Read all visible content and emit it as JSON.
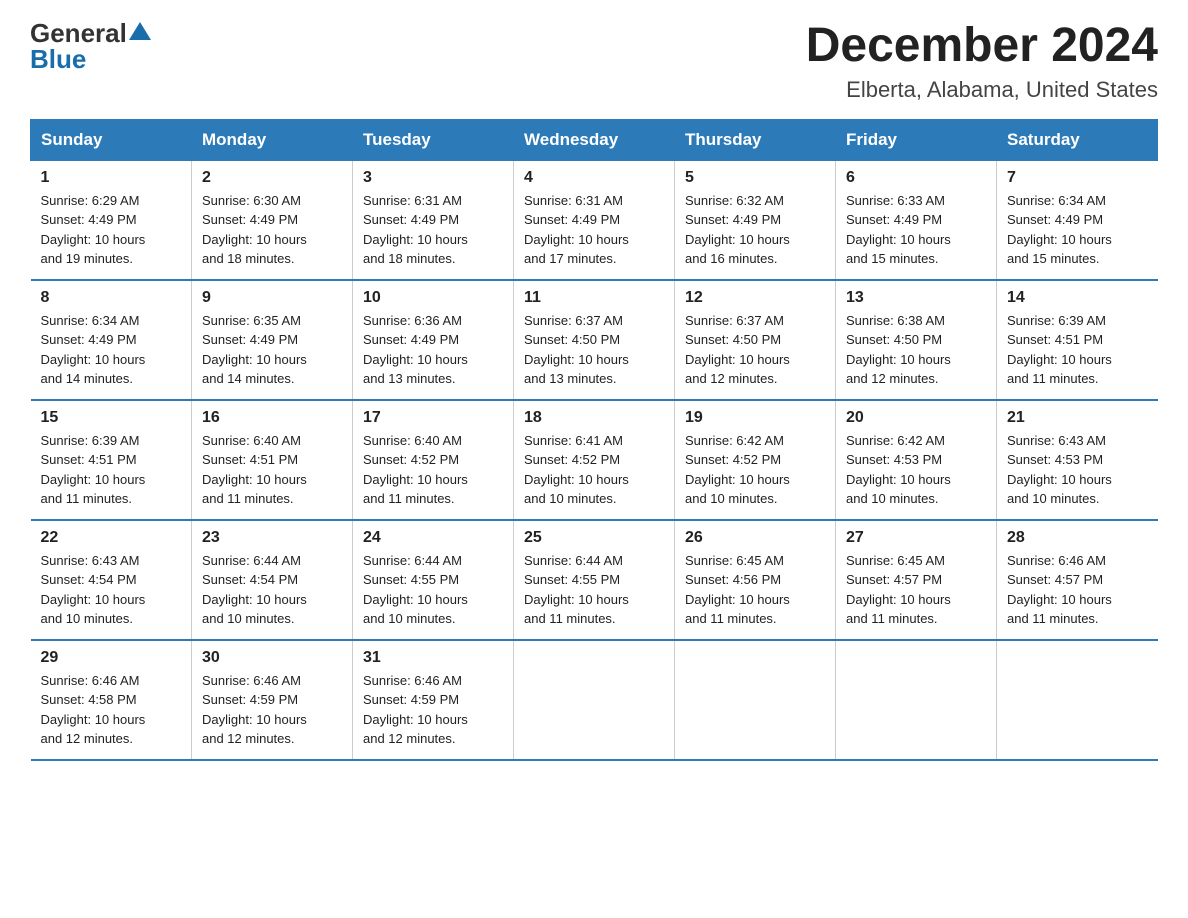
{
  "header": {
    "logo_general": "General",
    "logo_blue": "Blue",
    "title": "December 2024",
    "subtitle": "Elberta, Alabama, United States"
  },
  "days_of_week": [
    "Sunday",
    "Monday",
    "Tuesday",
    "Wednesday",
    "Thursday",
    "Friday",
    "Saturday"
  ],
  "weeks": [
    [
      {
        "day": "1",
        "sunrise": "6:29 AM",
        "sunset": "4:49 PM",
        "daylight": "10 hours and 19 minutes."
      },
      {
        "day": "2",
        "sunrise": "6:30 AM",
        "sunset": "4:49 PM",
        "daylight": "10 hours and 18 minutes."
      },
      {
        "day": "3",
        "sunrise": "6:31 AM",
        "sunset": "4:49 PM",
        "daylight": "10 hours and 18 minutes."
      },
      {
        "day": "4",
        "sunrise": "6:31 AM",
        "sunset": "4:49 PM",
        "daylight": "10 hours and 17 minutes."
      },
      {
        "day": "5",
        "sunrise": "6:32 AM",
        "sunset": "4:49 PM",
        "daylight": "10 hours and 16 minutes."
      },
      {
        "day": "6",
        "sunrise": "6:33 AM",
        "sunset": "4:49 PM",
        "daylight": "10 hours and 15 minutes."
      },
      {
        "day": "7",
        "sunrise": "6:34 AM",
        "sunset": "4:49 PM",
        "daylight": "10 hours and 15 minutes."
      }
    ],
    [
      {
        "day": "8",
        "sunrise": "6:34 AM",
        "sunset": "4:49 PM",
        "daylight": "10 hours and 14 minutes."
      },
      {
        "day": "9",
        "sunrise": "6:35 AM",
        "sunset": "4:49 PM",
        "daylight": "10 hours and 14 minutes."
      },
      {
        "day": "10",
        "sunrise": "6:36 AM",
        "sunset": "4:49 PM",
        "daylight": "10 hours and 13 minutes."
      },
      {
        "day": "11",
        "sunrise": "6:37 AM",
        "sunset": "4:50 PM",
        "daylight": "10 hours and 13 minutes."
      },
      {
        "day": "12",
        "sunrise": "6:37 AM",
        "sunset": "4:50 PM",
        "daylight": "10 hours and 12 minutes."
      },
      {
        "day": "13",
        "sunrise": "6:38 AM",
        "sunset": "4:50 PM",
        "daylight": "10 hours and 12 minutes."
      },
      {
        "day": "14",
        "sunrise": "6:39 AM",
        "sunset": "4:51 PM",
        "daylight": "10 hours and 11 minutes."
      }
    ],
    [
      {
        "day": "15",
        "sunrise": "6:39 AM",
        "sunset": "4:51 PM",
        "daylight": "10 hours and 11 minutes."
      },
      {
        "day": "16",
        "sunrise": "6:40 AM",
        "sunset": "4:51 PM",
        "daylight": "10 hours and 11 minutes."
      },
      {
        "day": "17",
        "sunrise": "6:40 AM",
        "sunset": "4:52 PM",
        "daylight": "10 hours and 11 minutes."
      },
      {
        "day": "18",
        "sunrise": "6:41 AM",
        "sunset": "4:52 PM",
        "daylight": "10 hours and 10 minutes."
      },
      {
        "day": "19",
        "sunrise": "6:42 AM",
        "sunset": "4:52 PM",
        "daylight": "10 hours and 10 minutes."
      },
      {
        "day": "20",
        "sunrise": "6:42 AM",
        "sunset": "4:53 PM",
        "daylight": "10 hours and 10 minutes."
      },
      {
        "day": "21",
        "sunrise": "6:43 AM",
        "sunset": "4:53 PM",
        "daylight": "10 hours and 10 minutes."
      }
    ],
    [
      {
        "day": "22",
        "sunrise": "6:43 AM",
        "sunset": "4:54 PM",
        "daylight": "10 hours and 10 minutes."
      },
      {
        "day": "23",
        "sunrise": "6:44 AM",
        "sunset": "4:54 PM",
        "daylight": "10 hours and 10 minutes."
      },
      {
        "day": "24",
        "sunrise": "6:44 AM",
        "sunset": "4:55 PM",
        "daylight": "10 hours and 10 minutes."
      },
      {
        "day": "25",
        "sunrise": "6:44 AM",
        "sunset": "4:55 PM",
        "daylight": "10 hours and 11 minutes."
      },
      {
        "day": "26",
        "sunrise": "6:45 AM",
        "sunset": "4:56 PM",
        "daylight": "10 hours and 11 minutes."
      },
      {
        "day": "27",
        "sunrise": "6:45 AM",
        "sunset": "4:57 PM",
        "daylight": "10 hours and 11 minutes."
      },
      {
        "day": "28",
        "sunrise": "6:46 AM",
        "sunset": "4:57 PM",
        "daylight": "10 hours and 11 minutes."
      }
    ],
    [
      {
        "day": "29",
        "sunrise": "6:46 AM",
        "sunset": "4:58 PM",
        "daylight": "10 hours and 12 minutes."
      },
      {
        "day": "30",
        "sunrise": "6:46 AM",
        "sunset": "4:59 PM",
        "daylight": "10 hours and 12 minutes."
      },
      {
        "day": "31",
        "sunrise": "6:46 AM",
        "sunset": "4:59 PM",
        "daylight": "10 hours and 12 minutes."
      },
      null,
      null,
      null,
      null
    ]
  ],
  "labels": {
    "sunrise": "Sunrise:",
    "sunset": "Sunset:",
    "daylight": "Daylight:"
  }
}
